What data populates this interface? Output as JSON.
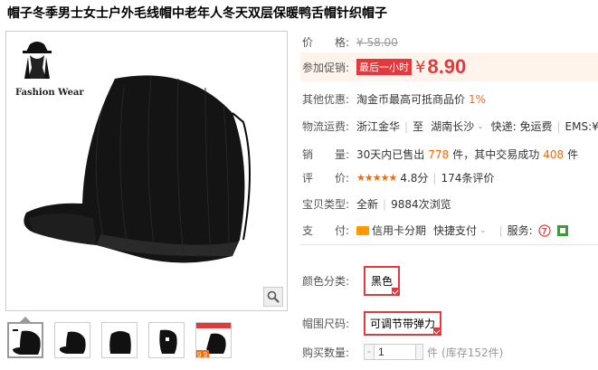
{
  "title": "帽子冬季男士女士户外毛线帽中老年人冬天双层保暖鸭舌帽针织帽子",
  "gallery": {
    "brand": "Fashion Wear",
    "thumb_count": 5,
    "thumb5_badge": "9.9"
  },
  "price": {
    "label": "价　　格:",
    "old": "¥ 58.00"
  },
  "promo": {
    "label": "参加促销:",
    "tag": "最后一小时",
    "currency": "¥",
    "value": "8.90"
  },
  "offers": {
    "label": "其他优惠:",
    "text": "淘金币最高可抵商品价",
    "pct": "1%"
  },
  "shipping": {
    "label": "物流运费:",
    "from": "浙江金华",
    "sep": "至",
    "to": "湖南长沙",
    "express": "快递: 免运费",
    "ems": "EMS:¥"
  },
  "sales": {
    "label": "销　　量:",
    "prefix": "30天内已售出",
    "sold": "778",
    "mid": "件，其中交易成功",
    "success": "408",
    "suffix": "件"
  },
  "rating": {
    "label": "评　　价:",
    "stars": "★★★★★",
    "score": "4.8分",
    "reviews": "174条评价"
  },
  "condition": {
    "label": "宝贝类型:",
    "type": "全新",
    "views": "9884次浏览"
  },
  "payment": {
    "label": "支　　付:",
    "credit": "信用卡分期",
    "quick": "快捷支付",
    "service_label": "服务:"
  },
  "color": {
    "label": "颜色分类:",
    "option": "黑色"
  },
  "size": {
    "label": "帽围尺码:",
    "option": "可调节带弹力"
  },
  "quantity": {
    "label": "购买数量:",
    "minus": "-",
    "value": "1",
    "unit": "件",
    "stock": "(库存152件)"
  },
  "colors": {
    "accent": "#e4393c",
    "orange": "#ff6600"
  }
}
